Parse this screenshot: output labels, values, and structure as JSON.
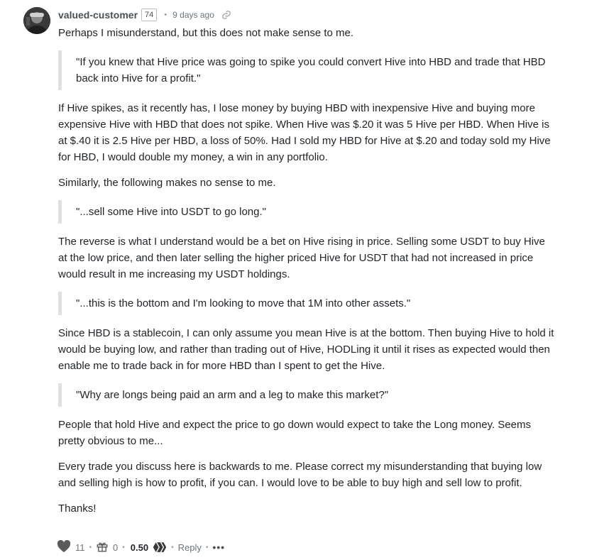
{
  "comment": {
    "author": "valued-customer",
    "reputation": "74",
    "separator": "•",
    "time": "9 days ago",
    "paragraphs": {
      "p1": "Perhaps I misunderstand, but this does not make sense to me.",
      "q1": "\"If you knew that Hive price was going to spike you could convert Hive into HBD and trade that HBD back into Hive for a profit.\"",
      "p2": "If Hive spikes, as it recently has, I lose money by buying HBD with inexpensive Hive and buying more expensive Hive with HBD that does not spike. When Hive was $.20 it was 5 Hive per HBD. When Hive is at $.40 it is 2.5 Hive per HBD, a loss of 50%. Had I sold my HBD for Hive at $.20 and today sold my Hive for HBD, I would double my money, a win in any portfolio.",
      "p3": "Similarly, the following makes no sense to me.",
      "q2": "\"...sell some Hive into USDT to go long.\"",
      "p4": "The reverse is what I understand would be a bet on Hive rising in price. Selling some USDT to buy Hive at the low price, and then later selling the higher priced Hive for USDT that had not increased in price would result in me increasing my USDT holdings.",
      "q3": "\"...this is the bottom and I'm looking to move that 1M into other assets.\"",
      "p5": "Since HBD is a stablecoin, I can only assume you mean Hive is at the bottom. Then buying Hive to hold it would be buying low, and rather than trading out of Hive, HODLing it until it rises as expected would then enable me to trade back in for more HBD than I spent to get the Hive.",
      "q4": "\"Why are longs being paid an arm and a leg to make this market?\"",
      "p6": "People that hold Hive and expect the price to go down would expect to take the Long money. Seems pretty obvious to me...",
      "p7": "Every trade you discuss here is backwards to me. Please correct my misunderstanding that buying low and selling high is how to profit, if you can. I would love to be able to buy high and sell low to profit.",
      "p8": "Thanks!"
    },
    "footer": {
      "votes": "11",
      "tips": "0",
      "payout": "0.50",
      "reply_label": "Reply",
      "more_label": "•••",
      "separator": "•"
    }
  },
  "icons": {
    "link": "link-icon",
    "heart": "heart-icon",
    "gift": "gift-icon",
    "hive": "hive-logo-icon"
  }
}
